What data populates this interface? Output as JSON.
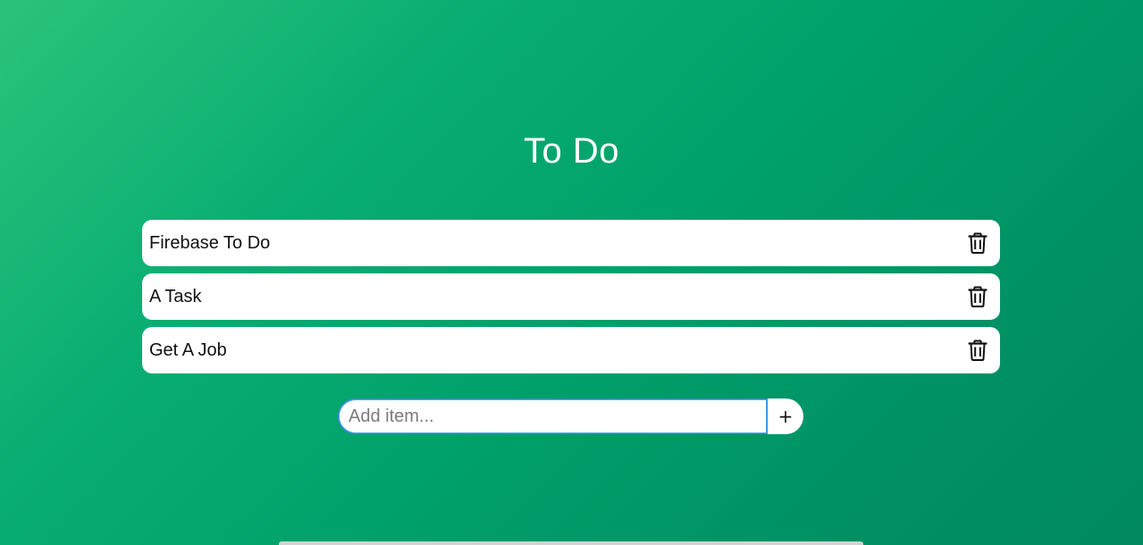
{
  "page": {
    "title": "To Do"
  },
  "todos": [
    {
      "text": "Firebase To Do",
      "delete_icon": "trash-icon"
    },
    {
      "text": "A Task",
      "delete_icon": "trash-icon"
    },
    {
      "text": "Get A Job",
      "delete_icon": "trash-icon"
    }
  ],
  "add_form": {
    "placeholder": "Add item...",
    "value": "",
    "button_label": "+"
  },
  "colors": {
    "background_start": "#2ac37a",
    "background_end": "#008a5e",
    "card": "#ffffff",
    "focus_ring": "#5aa9f0"
  }
}
